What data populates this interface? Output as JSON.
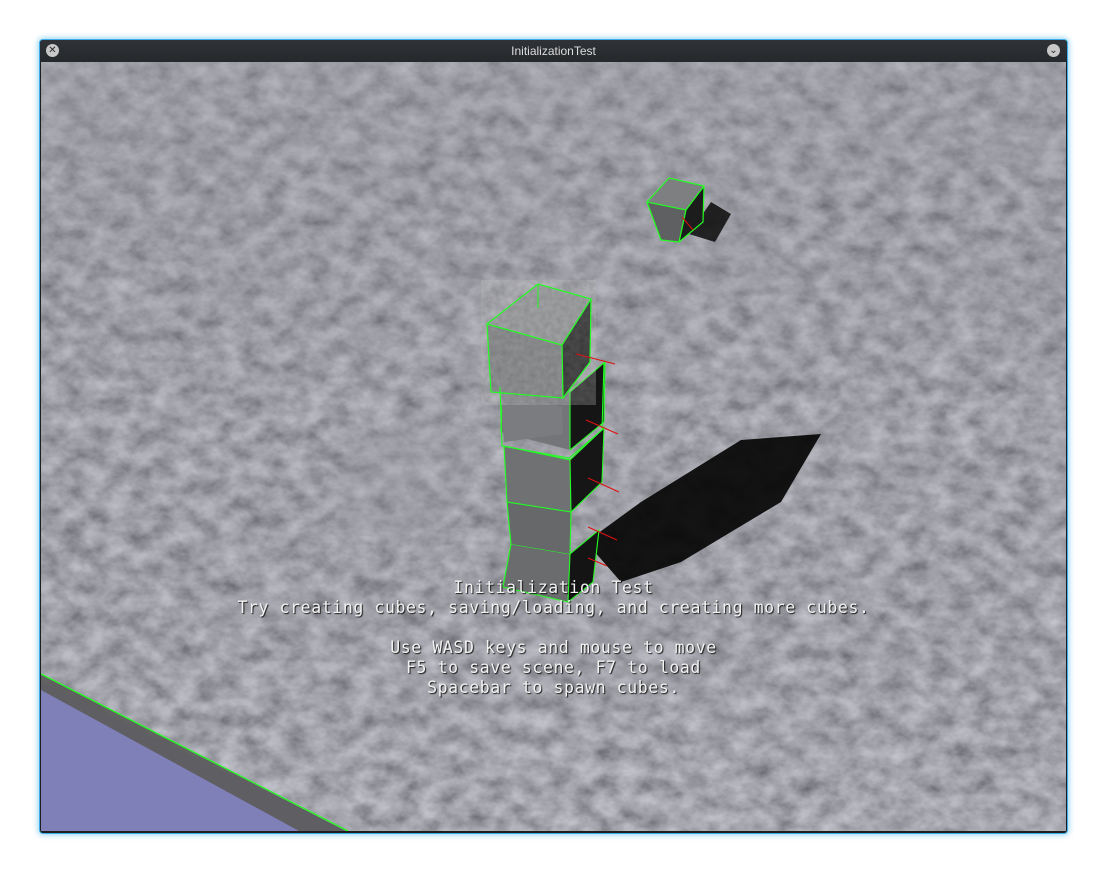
{
  "window": {
    "title": "InitializationTest",
    "close_icon": "close-icon",
    "menu_icon": "chevron-down-icon",
    "accent_color": "#3daee9"
  },
  "hud": {
    "title": "Initialization Test",
    "subtitle": "Try creating cubes, saving/loading, and creating more cubes.",
    "line1": "Use WASD keys and mouse to move",
    "line2": "F5 to save scene, F7 to load",
    "line3": "Spacebar to spawn cubes."
  },
  "scene": {
    "ground_color": "#5c5f63",
    "cube_outline_color": "#22ff22",
    "axis_color": "#dd1111",
    "floor_plane_color": "#8080b8",
    "cube_count": 5
  }
}
